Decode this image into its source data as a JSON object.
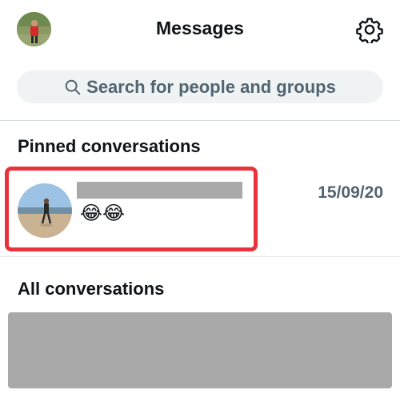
{
  "header": {
    "title": "Messages",
    "profile_icon": "profile-avatar",
    "settings_icon": "gear-icon"
  },
  "search": {
    "placeholder": "Search for people and groups",
    "icon": "search-icon"
  },
  "pinned": {
    "heading": "Pinned conversations",
    "conversations": [
      {
        "preview": "😂😂",
        "date": "15/09/20",
        "highlight_color": "#e8333b"
      }
    ]
  },
  "all": {
    "heading": "All conversations"
  },
  "colors": {
    "text_primary": "#0f1419",
    "text_secondary": "#536471",
    "search_bg": "#eff3f4",
    "redaction": "#a9a9a9"
  }
}
